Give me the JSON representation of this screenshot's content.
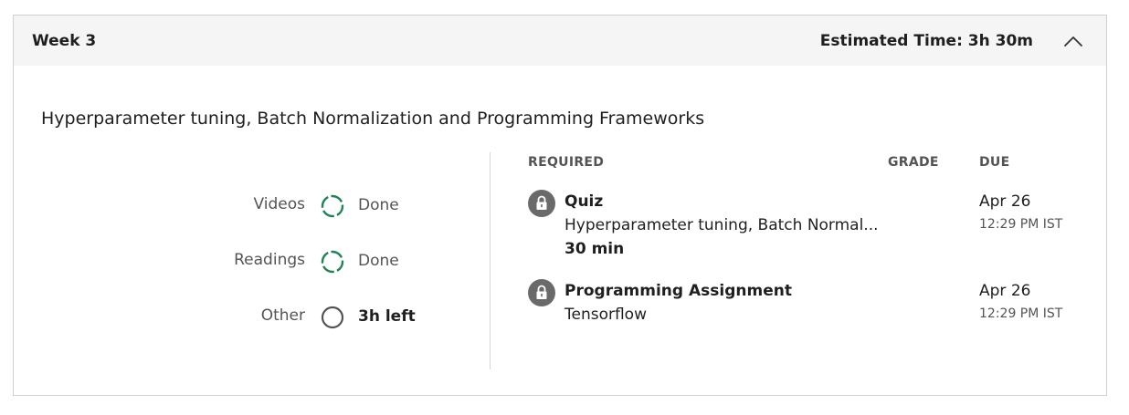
{
  "header": {
    "week_title": "Week 3",
    "estimated_time": "Estimated Time: 3h 30m",
    "collapse_icon": "chevron-up-icon"
  },
  "description": "Hyperparameter tuning, Batch Normalization and Programming Frameworks",
  "progress": [
    {
      "label": "Videos",
      "status": "Done",
      "state": "done",
      "color": "#1f8354",
      "icon": "progress-ring-icon"
    },
    {
      "label": "Readings",
      "status": "Done",
      "state": "done",
      "color": "#1f8354",
      "icon": "progress-ring-icon"
    },
    {
      "label": "Other",
      "status": "3h left",
      "state": "pending",
      "color": "#545454",
      "icon": "progress-ring-icon"
    }
  ],
  "columns": {
    "required": "REQUIRED",
    "grade": "GRADE",
    "due": "DUE"
  },
  "items": [
    {
      "type": "Quiz",
      "name": "Hyperparameter tuning, Batch Normal...",
      "duration": "30 min",
      "due_date": "Apr 26",
      "due_time": "12:29 PM IST",
      "icon": "lock-icon"
    },
    {
      "type": "Programming Assignment",
      "name": "Tensorflow",
      "duration": "",
      "due_date": "Apr 26",
      "due_time": "12:29 PM IST",
      "icon": "lock-icon"
    }
  ],
  "colors": {
    "done_green": "#1f8354",
    "icon_gray": "#6a6a6a",
    "header_bg": "#f5f5f5",
    "border": "#cfcfcf"
  }
}
